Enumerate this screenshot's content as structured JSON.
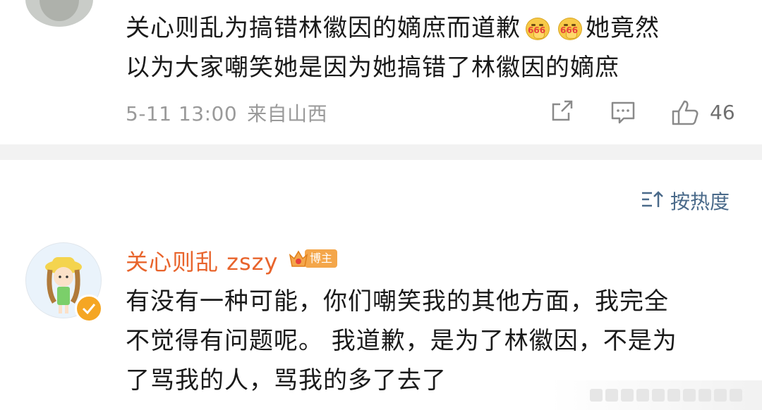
{
  "top_comment": {
    "line1_a": "关心则乱为搞错林徽因的嫡庶而道歉",
    "emoji_1": "666-thumbs-emoji",
    "emoji_2": "666-thumbs-emoji",
    "emoji_text": "666",
    "line1_b": "她竟然",
    "line2": "以为大家嘲笑她是因为她搞错了林徽因的嫡庶",
    "date": "5-11 13:00",
    "source": "来自山西",
    "like_count": "46"
  },
  "sort": {
    "label": "按热度",
    "icon": "sort-icon"
  },
  "reply": {
    "username": "关心则乱 zszy",
    "badge_label": "博主",
    "line1": "有没有一种可能，你们嘲笑我的其他方面，我完全",
    "line2": "不觉得有问题呢。 我道歉，是为了林徽因，不是为",
    "line3": "了骂我的人，骂我的多了去了"
  },
  "colors": {
    "username": "#e8642c",
    "meta": "#9a9a9a",
    "sort": "#4a6a8a",
    "divider": "#f2f2f2",
    "badge": "#f4a64a"
  }
}
